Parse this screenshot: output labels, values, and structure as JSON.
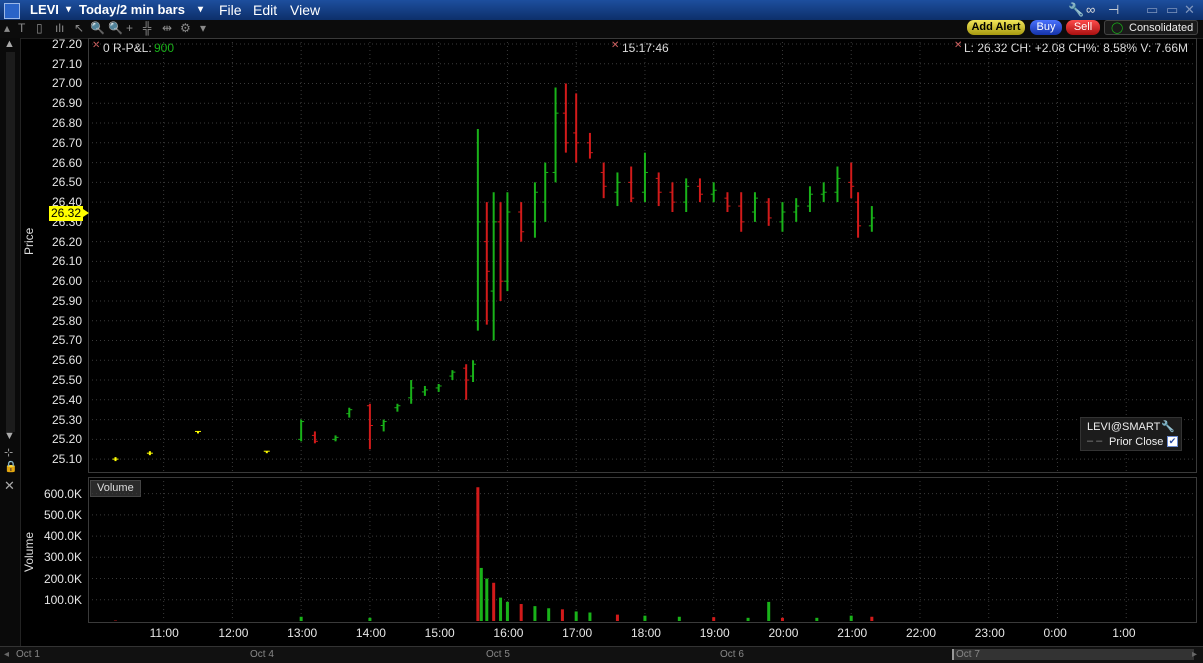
{
  "titlebar": {
    "symbol": "LEVI",
    "period": "Today/2 min bars",
    "menus": [
      "File",
      "Edit",
      "View"
    ]
  },
  "toolbar": {
    "add_alert": "Add Alert",
    "buy": "Buy",
    "sell": "Sell",
    "consolidated": "Consolidated"
  },
  "chart_header": {
    "pnl_label": "0 R-P&L:",
    "pnl_value": "900",
    "time": "15:17:46",
    "quote": "L: 26.32 CH: +2.08 CH%: 8.58% V: 7.66M"
  },
  "price_axis": {
    "label": "Price",
    "current": "26.32",
    "ticks": [
      "27.20",
      "27.10",
      "27.00",
      "26.90",
      "26.80",
      "26.70",
      "26.60",
      "26.50",
      "26.40",
      "26.30",
      "26.20",
      "26.10",
      "26.00",
      "25.90",
      "25.80",
      "25.70",
      "25.60",
      "25.50",
      "25.40",
      "25.30",
      "25.20",
      "25.10"
    ]
  },
  "volume_axis": {
    "label": "Volume",
    "panel_label": "Volume",
    "ticks": [
      "600.0K",
      "500.0K",
      "400.0K",
      "300.0K",
      "200.0K",
      "100.0K"
    ]
  },
  "time_axis": [
    "11:00",
    "12:00",
    "13:00",
    "14:00",
    "15:00",
    "16:00",
    "17:00",
    "18:00",
    "19:00",
    "20:00",
    "21:00",
    "22:00",
    "23:00",
    "0:00",
    "1:00"
  ],
  "legend": {
    "contract": "LEVI@SMART",
    "prior_close": "Prior Close"
  },
  "bottom_dates": [
    "Oct 1",
    "Oct 4",
    "Oct 5",
    "Oct 6",
    "Oct 7"
  ],
  "colors": {
    "up": "#19b219",
    "down": "#d21a1a",
    "neutral": "#ffff00",
    "grid": "#3a3a3a"
  },
  "chart_data": {
    "type": "candlestick",
    "ylim": [
      25.05,
      27.22
    ],
    "ohlc": [
      [
        10.3,
        25.1,
        25.11,
        25.09,
        25.1
      ],
      [
        10.8,
        25.13,
        25.14,
        25.12,
        25.13
      ],
      [
        11.5,
        25.24,
        25.24,
        25.23,
        25.24
      ],
      [
        12.5,
        25.14,
        25.14,
        25.13,
        25.14
      ],
      [
        13.0,
        25.2,
        25.3,
        25.19,
        25.29
      ],
      [
        13.2,
        25.22,
        25.24,
        25.18,
        25.19
      ],
      [
        13.5,
        25.2,
        25.22,
        25.19,
        25.21
      ],
      [
        13.7,
        25.33,
        25.36,
        25.31,
        25.35
      ],
      [
        14.0,
        25.37,
        25.38,
        25.15,
        25.27
      ],
      [
        14.2,
        25.27,
        25.3,
        25.24,
        25.29
      ],
      [
        14.4,
        25.36,
        25.38,
        25.34,
        25.37
      ],
      [
        14.6,
        25.41,
        25.5,
        25.38,
        25.46
      ],
      [
        14.8,
        25.44,
        25.47,
        25.42,
        25.45
      ],
      [
        15.0,
        25.46,
        25.48,
        25.44,
        25.47
      ],
      [
        15.2,
        25.52,
        25.55,
        25.5,
        25.54
      ],
      [
        15.4,
        25.56,
        25.58,
        25.4,
        25.5
      ],
      [
        15.5,
        25.52,
        25.6,
        25.49,
        25.58
      ],
      [
        15.57,
        25.8,
        26.77,
        25.75,
        26.3
      ],
      [
        15.7,
        26.2,
        26.4,
        25.78,
        26.05
      ],
      [
        15.8,
        25.95,
        26.45,
        25.7,
        26.3
      ],
      [
        15.9,
        26.3,
        26.4,
        25.9,
        26.0
      ],
      [
        16.0,
        26.0,
        26.45,
        25.95,
        26.35
      ],
      [
        16.2,
        26.35,
        26.4,
        26.2,
        26.25
      ],
      [
        16.4,
        26.3,
        26.5,
        26.22,
        26.45
      ],
      [
        16.55,
        26.4,
        26.6,
        26.3,
        26.55
      ],
      [
        16.7,
        26.55,
        26.98,
        26.5,
        26.85
      ],
      [
        16.85,
        26.85,
        27.0,
        26.65,
        26.7
      ],
      [
        17.0,
        26.75,
        26.95,
        26.6,
        26.7
      ],
      [
        17.2,
        26.7,
        26.75,
        26.62,
        26.65
      ],
      [
        17.4,
        26.55,
        26.6,
        26.42,
        26.48
      ],
      [
        17.6,
        26.45,
        26.55,
        26.38,
        26.5
      ],
      [
        17.8,
        26.5,
        26.58,
        26.4,
        26.42
      ],
      [
        18.0,
        26.45,
        26.65,
        26.4,
        26.55
      ],
      [
        18.2,
        26.52,
        26.55,
        26.38,
        26.45
      ],
      [
        18.4,
        26.45,
        26.5,
        26.35,
        26.4
      ],
      [
        18.6,
        26.4,
        26.52,
        26.35,
        26.48
      ],
      [
        18.8,
        26.48,
        26.52,
        26.4,
        26.44
      ],
      [
        19.0,
        26.44,
        26.5,
        26.4,
        26.46
      ],
      [
        19.2,
        26.42,
        26.45,
        26.35,
        26.38
      ],
      [
        19.4,
        26.38,
        26.45,
        26.25,
        26.3
      ],
      [
        19.6,
        26.35,
        26.45,
        26.3,
        26.42
      ],
      [
        19.8,
        26.4,
        26.42,
        26.28,
        26.32
      ],
      [
        20.0,
        26.3,
        26.4,
        26.25,
        26.35
      ],
      [
        20.2,
        26.35,
        26.42,
        26.3,
        26.38
      ],
      [
        20.4,
        26.38,
        26.48,
        26.35,
        26.44
      ],
      [
        20.6,
        26.44,
        26.5,
        26.4,
        26.45
      ],
      [
        20.8,
        26.45,
        26.58,
        26.4,
        26.52
      ],
      [
        21.0,
        26.5,
        26.6,
        26.42,
        26.48
      ],
      [
        21.1,
        26.4,
        26.45,
        26.22,
        26.28
      ],
      [
        21.3,
        26.28,
        26.38,
        26.25,
        26.32
      ]
    ],
    "volume": [
      [
        10.3,
        2000
      ],
      [
        13.0,
        20000
      ],
      [
        14.0,
        15000
      ],
      [
        15.57,
        630000
      ],
      [
        15.62,
        250000
      ],
      [
        15.7,
        200000
      ],
      [
        15.8,
        180000
      ],
      [
        15.9,
        110000
      ],
      [
        16.0,
        90000
      ],
      [
        16.2,
        80000
      ],
      [
        16.4,
        70000
      ],
      [
        16.6,
        60000
      ],
      [
        16.8,
        55000
      ],
      [
        17.0,
        45000
      ],
      [
        17.2,
        40000
      ],
      [
        17.6,
        30000
      ],
      [
        18.0,
        25000
      ],
      [
        18.5,
        20000
      ],
      [
        19.0,
        18000
      ],
      [
        19.5,
        15000
      ],
      [
        19.8,
        90000
      ],
      [
        20.0,
        15000
      ],
      [
        20.5,
        15000
      ],
      [
        21.0,
        25000
      ],
      [
        21.3,
        20000
      ]
    ]
  }
}
